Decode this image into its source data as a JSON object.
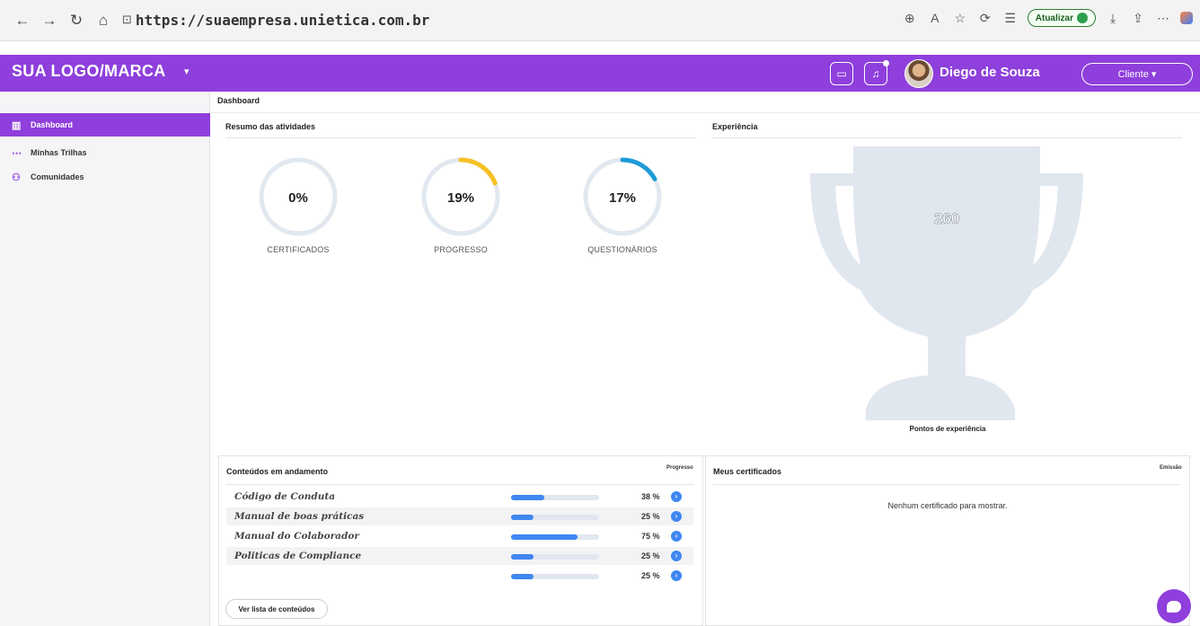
{
  "browser": {
    "back_icon": "←",
    "forward_icon": "→",
    "refresh_icon": "↻",
    "home_icon": "⌂",
    "lock_icon": "🔒",
    "url": "https://suaempresa.unietica.com.br",
    "update_label": "Atualizar"
  },
  "header": {
    "logo": "SUA LOGO/MARCA",
    "user_name": "Diego de Souza",
    "role_label": "Cliente ▾",
    "accent_color": "#8e3fdc"
  },
  "sidebar": {
    "items": [
      {
        "label": "Dashboard",
        "icon": "dashboard-icon",
        "active": true
      },
      {
        "label": "Minhas Trilhas",
        "icon": "dots-icon",
        "active": false
      },
      {
        "label": "Comunidades",
        "icon": "people-icon",
        "active": false
      }
    ]
  },
  "breadcrumb": "Dashboard",
  "summary": {
    "title": "Resumo das atividades",
    "gauges": [
      {
        "value": "0%",
        "percent": 0,
        "label": "CERTIFICADOS",
        "color": "#f6c026"
      },
      {
        "value": "19%",
        "percent": 19,
        "label": "PROGRESSO",
        "color": "#f6c026"
      },
      {
        "value": "17%",
        "percent": 17,
        "label": "QUESTIONÁRIOS",
        "color": "#1e9bd7"
      }
    ]
  },
  "experience": {
    "title": "Experiência",
    "points": "260",
    "points_label": "Pontos de experiência"
  },
  "contents": {
    "title": "Conteúdos em andamento",
    "column_label": "Progresso",
    "rows": [
      {
        "name": "Código de Conduta",
        "percent": 38,
        "percent_label": "38 %"
      },
      {
        "name": "Manual de boas práticas",
        "percent": 25,
        "percent_label": "25 %"
      },
      {
        "name": "Manual do Colaborador",
        "percent": 75,
        "percent_label": "75 %"
      },
      {
        "name": "Politicas de Compliance",
        "percent": 25,
        "percent_label": "25 %"
      },
      {
        "name": "",
        "percent": 25,
        "percent_label": "25 %"
      }
    ],
    "list_button": "Ver lista de conteúdos"
  },
  "certificates": {
    "title": "Meus certificados",
    "column_label": "Emissão",
    "empty_message": "Nenhum certificado para mostrar."
  }
}
